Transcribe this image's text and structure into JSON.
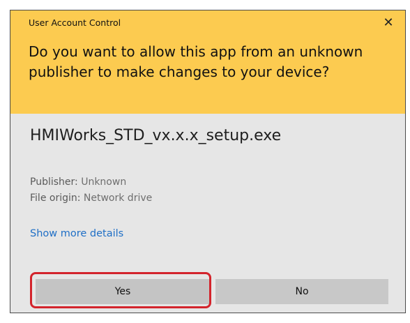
{
  "dialog": {
    "title": "User Account Control",
    "close_glyph": "✕",
    "question": "Do you want to allow this app from an unknown publisher to make changes to your device?",
    "app_name": "HMIWorks_STD_vx.x.x_setup.exe",
    "publisher_label": "Publisher: ",
    "publisher_value": "Unknown",
    "origin_label": "File origin: ",
    "origin_value": "Network drive",
    "more_details": "Show more details",
    "yes_label": "Yes",
    "no_label": "No"
  },
  "colors": {
    "header_bg": "#fccb50",
    "body_bg": "#e6e6e6",
    "link": "#1f6fc6",
    "highlight": "#d3242c",
    "button_bg": "#c8c8c8"
  },
  "icons": {
    "close": "close-icon"
  }
}
